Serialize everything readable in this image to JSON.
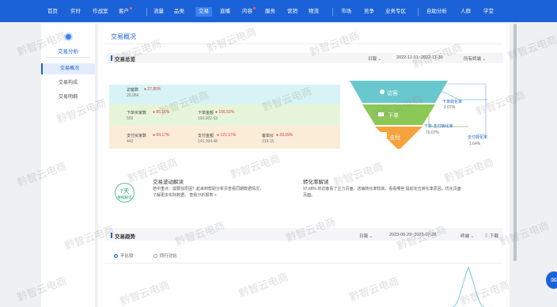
{
  "nav": {
    "items": [
      "首页",
      "实时",
      "作战室",
      "客户",
      "流量",
      "品类",
      "交易",
      "直播",
      "内容",
      "服务",
      "营销",
      "物流",
      "市场",
      "竞争",
      "业务专区",
      "自助分析",
      "人群",
      "学堂"
    ],
    "active_index": 6
  },
  "sidebar": {
    "title": "交易分析",
    "items": [
      "交易概况",
      "交易构成",
      "交易明细"
    ],
    "active_index": 0
  },
  "page": {
    "title": "交易概况"
  },
  "overview": {
    "title": "交易总览",
    "granularity": "日報",
    "date_range": "2022-11-01~2022-11-30",
    "terminal": "所有终端"
  },
  "metrics": {
    "visitors": {
      "label": "访客数",
      "pct": "27.85%",
      "value": "26,964"
    },
    "order_buyers": {
      "label": "下单买家数",
      "pct": "85.16%",
      "value": "559"
    },
    "order_amount": {
      "label": "下单金额",
      "pct": "106.52%",
      "value": "193,902.63"
    },
    "pay_buyers": {
      "label": "支付买家数",
      "pct": "84.17%",
      "value": "442"
    },
    "pay_amount": {
      "label": "支付金额",
      "pct": "121.17%",
      "value": "141,064.48"
    },
    "unit_price": {
      "label": "客单价",
      "pct": "20.09%",
      "value": "319.15"
    }
  },
  "funnel": {
    "stage1": "访客",
    "stage2": "下单",
    "stage3": "支付",
    "order_conv_label": "下单转化率",
    "order_conv_value": "2.07%",
    "pay_conv_label": "下单-支付转化率",
    "pay_conv_value": "79.07%",
    "total_conv_label": "支付转化率",
    "total_conv_value": "1.64%"
  },
  "fluctuation": {
    "bubble_big": "7天",
    "bubble_small": "数据解读",
    "title": "交易波动解读",
    "line1": "若中重点：需要找原因？起来到帮助分析页查看同期数据情况，",
    "line2": "了解更多实际数据。  查看分析报表 >",
    "link": "去帮助分析",
    "report": "查看分析报表"
  },
  "conversion": {
    "title": "转化率解读",
    "line1": "97.68% 的访客看了主力页面，店铺转化率较高，看看哪些  提前定位转化率原因，优化页面",
    "line2": "页面。",
    "pct": "97.68%"
  },
  "trend": {
    "title": "交易趋势",
    "granularity": "日報",
    "date_range": "2023-06-29~2023-07-28",
    "terminal": "终端",
    "download": "下载",
    "radio_compare": "不比较",
    "radio_peer": "同行对比"
  },
  "watermark": "黔智云电商",
  "colors": {
    "brand": "#1b62d8",
    "visit_band": "#d7f3f5",
    "order_band": "#e6f5d9",
    "pay_band": "#fbecd8",
    "funnel_visit": "#69c8cd",
    "funnel_order": "#8cc855",
    "funnel_pay": "#f5a33f",
    "pct_up": "#d83b3b"
  }
}
